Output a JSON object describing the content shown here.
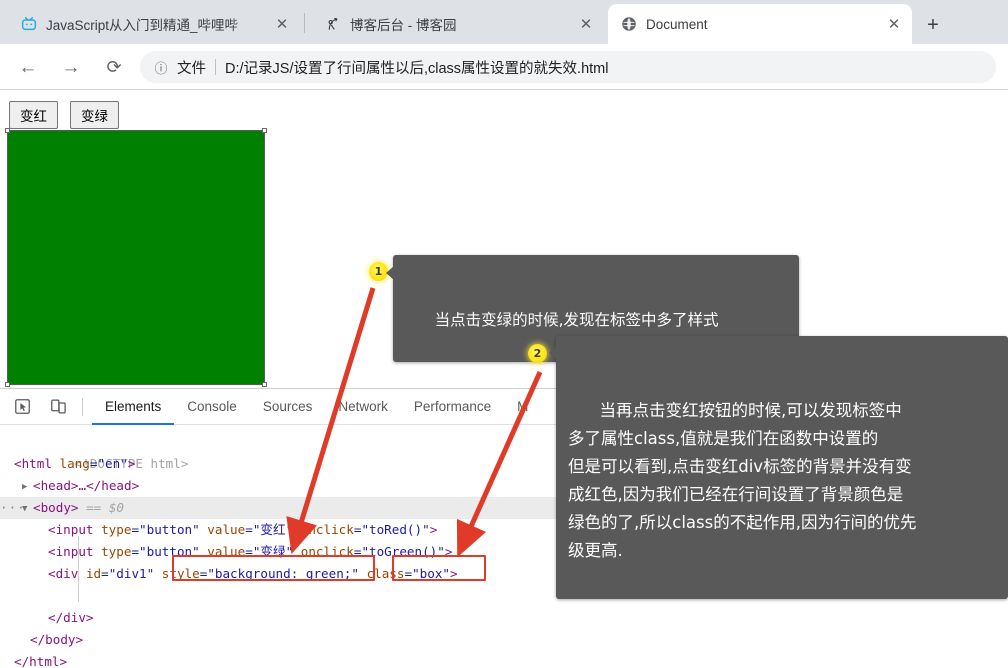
{
  "browser": {
    "tabs": [
      {
        "title": "JavaScript从入门到精通_哔哩哔",
        "favicon": "bilibili-icon",
        "active": false,
        "close_label": "✕"
      },
      {
        "title": "博客后台 - 博客园",
        "favicon": "cnblogs-icon",
        "active": false,
        "close_label": "✕"
      },
      {
        "title": "Document",
        "favicon": "globe-icon",
        "active": true,
        "close_label": "✕"
      }
    ],
    "new_tab_label": "+",
    "nav": {
      "back_label": "←",
      "forward_label": "→",
      "reload_label": "⟳"
    },
    "omnibox": {
      "info_label": "ⓘ",
      "scheme_label": "文件",
      "url": "D:/记录JS/设置了行间属性以后,class属性设置的就失效.html"
    }
  },
  "page": {
    "buttons": [
      {
        "label": "变红"
      },
      {
        "label": "变绿"
      }
    ],
    "box": {
      "color": "#008000"
    }
  },
  "devtools": {
    "icons": {
      "inspect": "inspect-element-icon",
      "device": "device-toolbar-icon"
    },
    "tabs": [
      {
        "label": "Elements",
        "active": true
      },
      {
        "label": "Console",
        "active": false
      },
      {
        "label": "Sources",
        "active": false
      },
      {
        "label": "Network",
        "active": false
      },
      {
        "label": "Performance",
        "active": false
      },
      {
        "label": "M",
        "active": false
      }
    ],
    "dom": {
      "doctype": "<!DOCTYPE html>",
      "html_open_tag": "<html",
      "html_attr_name": "lang",
      "html_attr_value": "\"en\"",
      "html_close_bracket": ">",
      "head_collapsed": "<head>…</head>",
      "body_open": "<body>",
      "body_selected_marker": "== $0",
      "dots_marker": "···",
      "input_red": {
        "tag_open": "<input",
        "attr_type": "type",
        "val_type": "\"button\"",
        "attr_value": "value",
        "val_value": "\"变红\"",
        "attr_onclick": "onclick",
        "val_onclick": "\"toRed()\"",
        "close": ">"
      },
      "input_green": {
        "tag_open": "<input",
        "attr_type": "type",
        "val_type": "\"button\"",
        "attr_value": "value",
        "val_value": "\"变绿\"",
        "attr_onclick": "onclick",
        "val_onclick": "\"toGreen()\"",
        "close": ">"
      },
      "div_line": {
        "tag_open": "<div",
        "attr_id": "id",
        "val_id": "\"div1\"",
        "attr_style": "style",
        "val_style": "\"background: green;\"",
        "attr_class": "class",
        "val_class": "\"box\"",
        "close": ">"
      },
      "div_close": "</div>",
      "body_close": "</body>",
      "html_close": "</html>"
    }
  },
  "annotations": {
    "badges": [
      {
        "number": "1"
      },
      {
        "number": "2"
      }
    ],
    "tooltips": [
      {
        "text": "当点击变绿的时候,发现在标签中多了样式"
      },
      {
        "text": "当再点击变红按钮的时候,可以发现标签中\n多了属性class,值就是我们在函数中设置的\n但是可以看到,点击变红div标签的背景并没有变\n成红色,因为我们已经在行间设置了背景颜色是\n绿色的了,所以class的不起作用,因为行间的优先\n级更高."
      }
    ],
    "highlight_color": "#e03b28"
  }
}
